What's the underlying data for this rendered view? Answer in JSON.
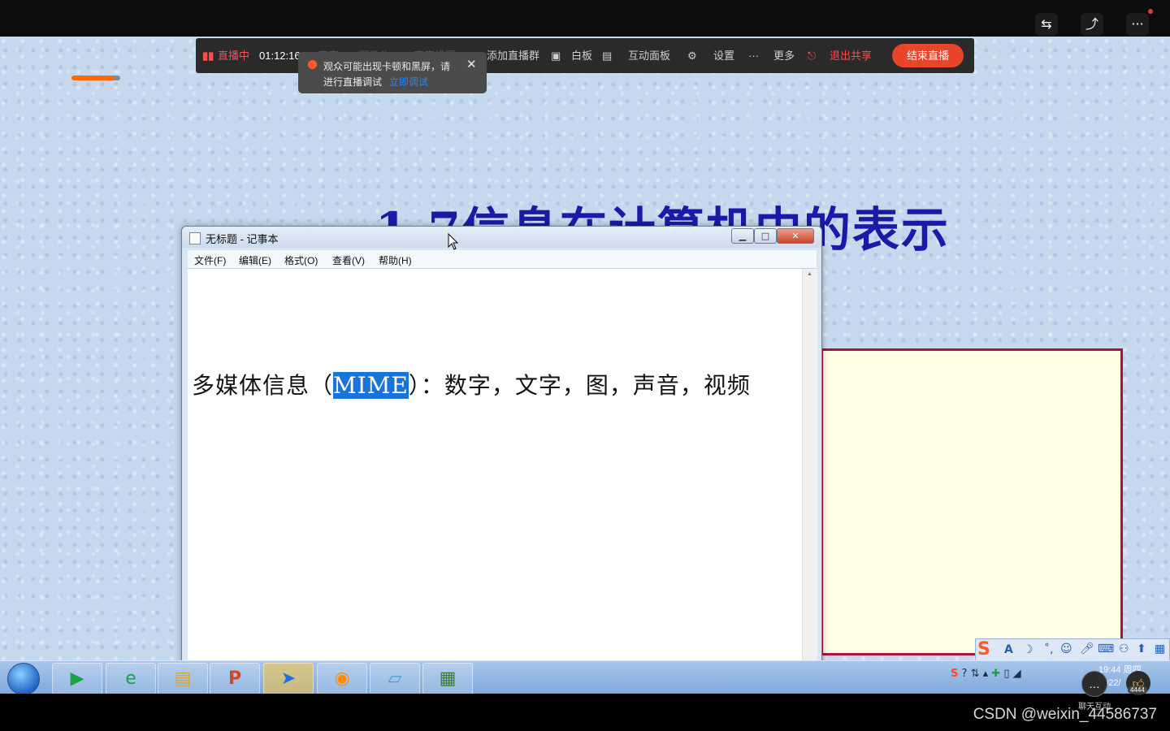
{
  "topbar": {
    "icons": [
      "screen-share-icon",
      "rotate-share-icon",
      "more-icon"
    ]
  },
  "livebar": {
    "status": "直播中",
    "timer": "01:12:16",
    "items": [
      "麦克",
      "摄像头",
      "声音设置",
      "添加直播群",
      "白板",
      "互动面板",
      "设置",
      "更多"
    ],
    "exit_share": "退出共享",
    "end_live": "结束直播"
  },
  "tooltip": {
    "line1": "观众可能出现卡顿和黑屏，请",
    "line2": "进行直播调试",
    "link": "立即调试"
  },
  "slide": {
    "title": "1.7信息在计算机中的表示"
  },
  "notepad": {
    "title": "无标题 - 记事本",
    "menu": [
      "文件(F)",
      "编辑(E)",
      "格式(O)",
      "查看(V)",
      "帮助(H)"
    ],
    "text_before": "多媒体信息（",
    "text_selected": "MIME",
    "text_after": "）：数字，文字，图，声音，视频"
  },
  "taskbar": {
    "apps": [
      "media-player",
      "ie-browser",
      "file-explorer",
      "powerpoint",
      "feishu",
      "media-app",
      "notepad",
      "presentation"
    ],
    "clock_time": "19:44",
    "clock_day": "周四",
    "clock_date": "2022/"
  },
  "ime": {
    "label": "A"
  },
  "overlay": {
    "chat_label": "聊天互动",
    "like_count": "4444"
  },
  "watermark": "CSDN @weixin_44586737"
}
